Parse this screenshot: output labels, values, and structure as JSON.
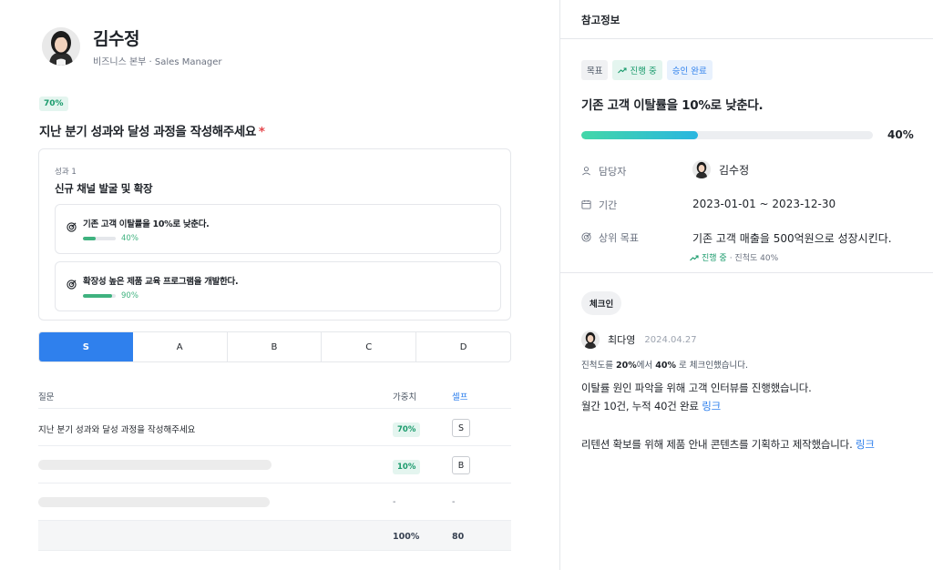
{
  "profile": {
    "name": "김수정",
    "subtitle": "비즈니스 본부 · Sales Manager"
  },
  "question": {
    "weight_badge": "70%",
    "title": "지난 분기 성과와 달성 과정을 작성해주세요",
    "required_mark": "*"
  },
  "outcome_card": {
    "label": "성과 1",
    "title": "신규 채널 발굴 및 확장",
    "key_results": [
      {
        "text": "기존 고객 이탈률을 10%로 낮춘다.",
        "progress_label": "40%",
        "progress": 0.4
      },
      {
        "text": "확장성 높은 제품 교육 프로그램을 개발한다.",
        "progress_label": "90%",
        "progress": 0.9
      }
    ]
  },
  "grades": [
    "S",
    "A",
    "B",
    "C",
    "D"
  ],
  "selected_grade": "S",
  "table": {
    "headers": {
      "question": "질문",
      "weight": "가중치",
      "self": "셀프"
    },
    "rows": [
      {
        "question": "지난 분기 성과와 달성 과정을 작성해주세요",
        "weight": "70%",
        "self": "S"
      },
      {
        "question": "",
        "weight": "10%",
        "self": "B"
      },
      {
        "question": "",
        "weight": "-",
        "self": "-"
      }
    ],
    "footer": {
      "weight": "100%",
      "self": "80"
    }
  },
  "side_panel": {
    "header": "참고정보",
    "tags": {
      "goal": "목표",
      "status": "진행 중",
      "approval": "승인 완료"
    },
    "goal_title": "기존 고객 이탈률을 10%로 낮춘다.",
    "progress_label": "40%",
    "progress": 0.4,
    "owner_label": "담당자",
    "owner_name": "김수정",
    "period_label": "기간",
    "period_value": "2023-01-01 ~ 2023-12-30",
    "parent_label": "상위 목표",
    "parent_value": "기존 고객 매출을 500억원으로 성장시킨다.",
    "parent_status": "진행 중",
    "parent_progress": "· 진척도 40%"
  },
  "checkin": {
    "badge": "체크인",
    "author": "최다영",
    "date": "2024.04.27",
    "progress_prefix": "진척도를",
    "progress_from": "20%",
    "progress_mid": "에서",
    "progress_to": "40%",
    "progress_suffix": "로 체크인했습니다.",
    "line1": "이탈률 원인 파악을 위해 고객 인터뷰를 진행했습니다.",
    "line2": "월간 10건, 누적 40건 완료",
    "line3": "리텐션 확보를 위해 제품 안내 콘텐츠를 기획하고 제작했습니다.",
    "link_label": "링크"
  },
  "colors": {
    "accent": "#2f80ed",
    "green": "#1a9b6c",
    "required": "#e5484d"
  },
  "icons": [
    "target-icon",
    "user-icon",
    "calendar-icon",
    "trending-up-icon"
  ]
}
